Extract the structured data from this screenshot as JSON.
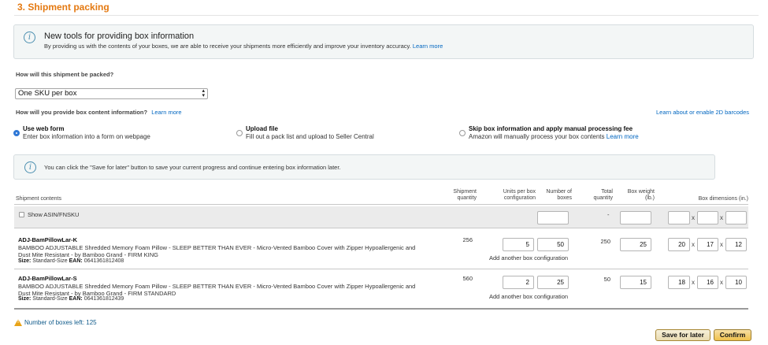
{
  "section": {
    "title": "3. Shipment packing"
  },
  "info_box": {
    "heading": "New tools for providing box information",
    "body": "By providing us with the contents of your boxes, we are able to receive your shipments more efficiently and improve your inventory accuracy.",
    "link": "Learn more"
  },
  "packing": {
    "question": "How will this shipment be packed?",
    "selected": "One SKU per box"
  },
  "box_content": {
    "question": "How will you provide box content information?",
    "learn_more": "Learn more",
    "barcodes_link": "Learn about or enable 2D barcodes",
    "options": [
      {
        "title": "Use web form",
        "desc": "Enter box information into a form on webpage",
        "selected": true
      },
      {
        "title": "Upload file",
        "desc": "Fill out a pack list and upload to Seller Central",
        "selected": false
      },
      {
        "title": "Skip box information and apply manual processing fee",
        "desc": "Amazon will manually process your box contents",
        "link": "Learn more",
        "selected": false
      }
    ]
  },
  "save_note": "You can click the \"Save for later\" button to save your current progress and continue entering box information later.",
  "table": {
    "headers": {
      "contents": "Shipment contents",
      "qty": [
        "Shipment",
        "quantity"
      ],
      "units": [
        "Units per box",
        "configuration"
      ],
      "boxes": [
        "Number of",
        "boxes"
      ],
      "total": [
        "Total",
        "quantity"
      ],
      "weight": [
        "Box weight",
        "(lb.)"
      ],
      "dims": "Box dimensions (in.)"
    },
    "show_asin_label": "Show ASIN/FNSKU",
    "total_dash": "-",
    "add_config": "Add another box configuration",
    "rows": [
      {
        "sku": "ADJ-BamPillowLar-K",
        "desc": "BAMBOO ADJUSTABLE Shredded Memory Foam Pillow - SLEEP BETTER THAN EVER - Micro-Vented Bamboo Cover with Zipper Hypoallergenic and Dust Mite Resistant - by Bamboo Grand - FIRM KING",
        "size_label": "Size:",
        "size": "Standard-Size",
        "ean_label": "EAN:",
        "ean": "0641361812408",
        "quantity": "256",
        "units": "5",
        "boxes": "50",
        "total": "250",
        "weight": "25",
        "dims": [
          "20",
          "17",
          "12"
        ]
      },
      {
        "sku": "ADJ-BamPillowLar-S",
        "desc": "BAMBOO ADJUSTABLE Shredded Memory Foam Pillow - SLEEP BETTER THAN EVER - Micro-Vented Bamboo Cover with Zipper Hypoallergenic and Dust Mite Resistant - by Bamboo Grand - FIRM STANDARD",
        "size_label": "Size:",
        "size": "Standard-Size",
        "ean_label": "EAN:",
        "ean": "0641361812439",
        "quantity": "560",
        "units": "2",
        "boxes": "25",
        "total": "50",
        "weight": "15",
        "dims": [
          "18",
          "16",
          "10"
        ]
      }
    ]
  },
  "footer": {
    "boxes_left": "Number of boxes left: 125",
    "save_button": "Save for later",
    "confirm_button": "Confirm"
  }
}
